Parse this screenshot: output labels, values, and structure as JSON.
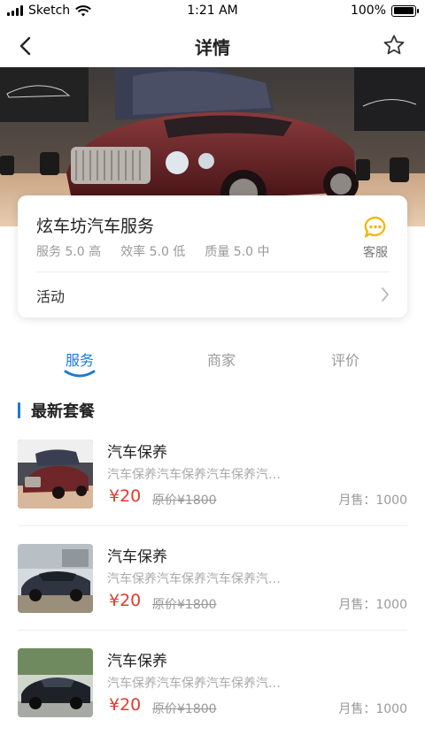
{
  "status": {
    "carrier": "Sketch",
    "time": "1:21 AM",
    "battery": "100%",
    "battery_level": 1.0
  },
  "nav": {
    "title": "详情"
  },
  "shop": {
    "name": "炫车坊汽车服务",
    "ratings": [
      "服务 5.0 高",
      "效率 5.0 低",
      "质量 5.0 中"
    ],
    "cs_label": "客服",
    "activity_label": "活动"
  },
  "tabs": [
    {
      "label": "服务",
      "active": true
    },
    {
      "label": "商家",
      "active": false
    },
    {
      "label": "评价",
      "active": false
    }
  ],
  "section": {
    "title": "最新套餐"
  },
  "packages": [
    {
      "name": "汽车保养",
      "desc": "汽车保养汽车保养汽车保养汽车保养",
      "price": "¥20",
      "orig": "原价¥1800",
      "sold": "月售：1000"
    },
    {
      "name": "汽车保养",
      "desc": "汽车保养汽车保养汽车保养汽车保养",
      "price": "¥20",
      "orig": "原价¥1800",
      "sold": "月售：1000"
    },
    {
      "name": "汽车保养",
      "desc": "汽车保养汽车保养汽车保养汽车保养",
      "price": "¥20",
      "orig": "原价¥1800",
      "sold": "月售：1000"
    }
  ],
  "colors": {
    "accent": "#1a7bd8",
    "price": "#e03c2c",
    "cs_icon": "#f5b400"
  }
}
